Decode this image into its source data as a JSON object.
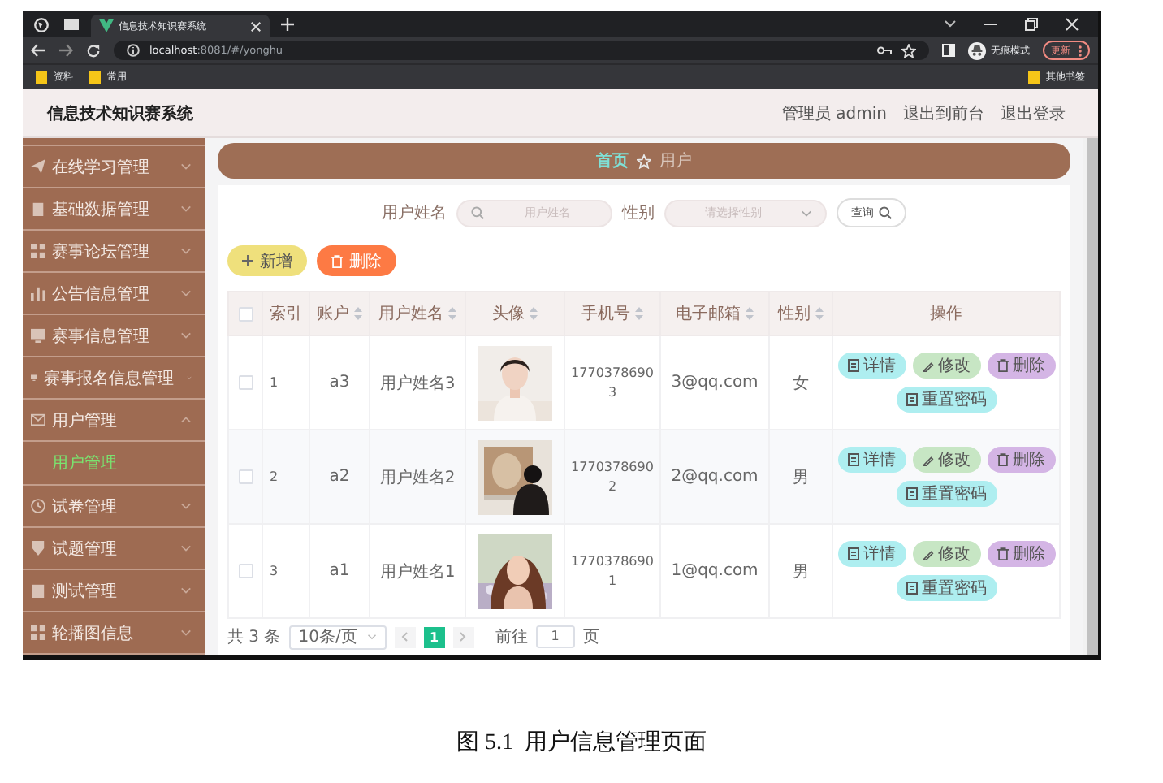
{
  "browser": {
    "tabs": [
      {
        "title": "信息技术知识赛系统",
        "selected": true
      }
    ],
    "url_host": "localhost",
    "url_rest": ":8081/#/yonghu",
    "profile_label": "无痕模式",
    "update_button": "更新",
    "bookmarks": [
      "资料",
      "常用"
    ],
    "other_bookmarks": "其他书签"
  },
  "app": {
    "title": "信息技术知识赛系统",
    "header_links": [
      "管理员 admin",
      "退出到前台",
      "退出登录"
    ]
  },
  "sidebar": {
    "items": [
      {
        "label": "在线学习管理",
        "expanded": false
      },
      {
        "label": "基础数据管理",
        "expanded": false
      },
      {
        "label": "赛事论坛管理",
        "expanded": false
      },
      {
        "label": "公告信息管理",
        "expanded": false
      },
      {
        "label": "赛事信息管理",
        "expanded": false
      },
      {
        "label": "赛事报名信息管理",
        "expanded": false
      },
      {
        "label": "用户管理",
        "expanded": true,
        "children": [
          {
            "label": "用户管理",
            "selected": true
          }
        ]
      },
      {
        "label": "试卷管理",
        "expanded": false
      },
      {
        "label": "试题管理",
        "expanded": false
      },
      {
        "label": "测试管理",
        "expanded": false
      },
      {
        "label": "轮播图信息",
        "expanded": false
      }
    ]
  },
  "breadcrumb": [
    {
      "label": "首页",
      "current": false
    },
    {
      "label": "用户",
      "current": true
    }
  ],
  "search": {
    "fields": [
      {
        "kind": "input",
        "label": "用户姓名",
        "placeholder": "用户姓名"
      },
      {
        "kind": "select",
        "label": "性别",
        "placeholder": "请选择性别"
      }
    ],
    "button": "查询"
  },
  "actions": [
    {
      "kind": "add",
      "label": "新增"
    },
    {
      "kind": "delete",
      "label": "删除"
    }
  ],
  "table": {
    "select_all": {
      "checked": false
    },
    "columns": [
      {
        "label": "索引",
        "sortable": false
      },
      {
        "label": "账户",
        "sortable": true
      },
      {
        "label": "用户姓名",
        "sortable": true
      },
      {
        "label": "头像",
        "sortable": true
      },
      {
        "label": "手机号",
        "sortable": true
      },
      {
        "label": "电子邮箱",
        "sortable": true
      },
      {
        "label": "性别",
        "sortable": true
      },
      {
        "label": "操作",
        "sortable": false
      }
    ],
    "rows": [
      {
        "checked": false,
        "index": "1",
        "account": "a3",
        "name": "用户姓名3",
        "phone": "17703786903",
        "email": "3@qq.com",
        "gender": "女",
        "actions": [
          {
            "kind": "detail",
            "label": "详情"
          },
          {
            "kind": "edit",
            "label": "修改"
          },
          {
            "kind": "delete",
            "label": "删除"
          },
          {
            "kind": "reset",
            "label": "重置密码"
          }
        ]
      },
      {
        "checked": false,
        "index": "2",
        "account": "a2",
        "name": "用户姓名2",
        "phone": "17703786902",
        "email": "2@qq.com",
        "gender": "男",
        "actions": [
          {
            "kind": "detail",
            "label": "详情"
          },
          {
            "kind": "edit",
            "label": "修改"
          },
          {
            "kind": "delete",
            "label": "删除"
          },
          {
            "kind": "reset",
            "label": "重置密码"
          }
        ]
      },
      {
        "checked": false,
        "index": "3",
        "account": "a1",
        "name": "用户姓名1",
        "phone": "17703786901",
        "email": "1@qq.com",
        "gender": "男",
        "actions": [
          {
            "kind": "detail",
            "label": "详情"
          },
          {
            "kind": "edit",
            "label": "修改"
          },
          {
            "kind": "delete",
            "label": "删除"
          },
          {
            "kind": "reset",
            "label": "重置密码"
          }
        ]
      }
    ]
  },
  "pagination": {
    "total": "共 3 条",
    "page_size": "10条/页",
    "pages": [
      {
        "label": "1",
        "selected": true
      }
    ],
    "goto_label": "前往",
    "goto_value": "1",
    "goto_suffix": "页"
  },
  "caption": "图 5.1  用户信息管理页面"
}
